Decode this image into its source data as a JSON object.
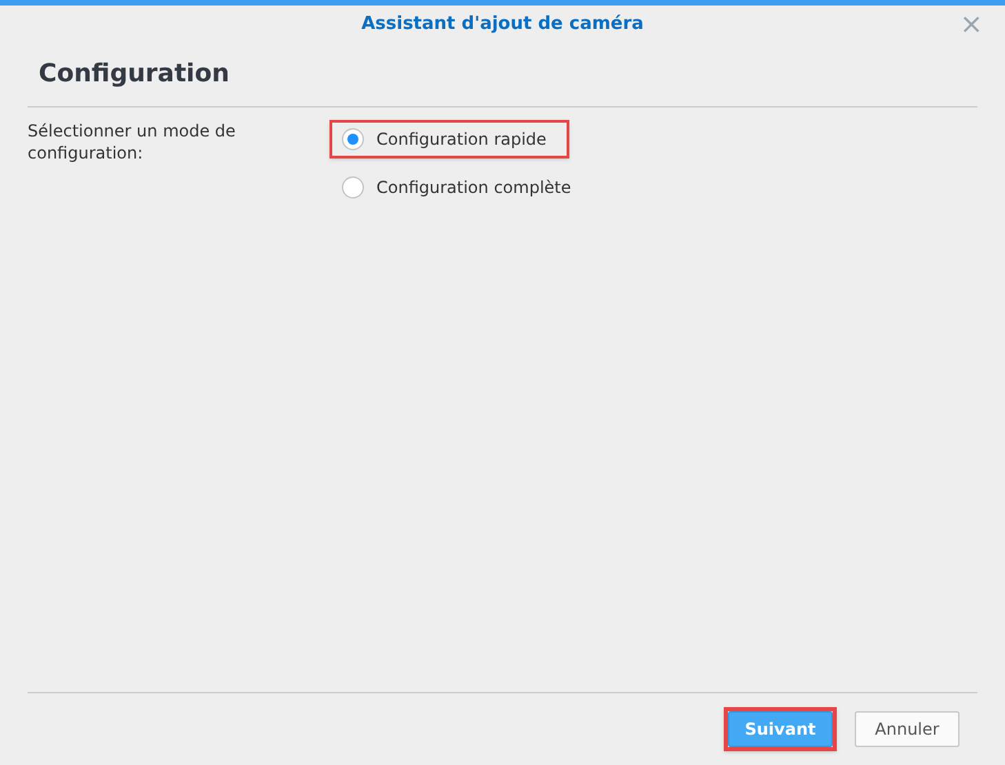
{
  "window": {
    "title": "Assistant d'ajout de caméra",
    "close": "×"
  },
  "heading": "Configuration",
  "field": {
    "label": "Sélectionner un mode de configuration:",
    "options": [
      {
        "label": "Configuration rapide",
        "selected": true,
        "highlighted": true
      },
      {
        "label": "Configuration complète",
        "selected": false,
        "highlighted": false
      }
    ]
  },
  "buttons": [
    {
      "kind": "primary",
      "label": "Suivant",
      "highlighted": true
    },
    {
      "kind": "secondary",
      "label": "Annuler",
      "highlighted": false
    }
  ]
}
